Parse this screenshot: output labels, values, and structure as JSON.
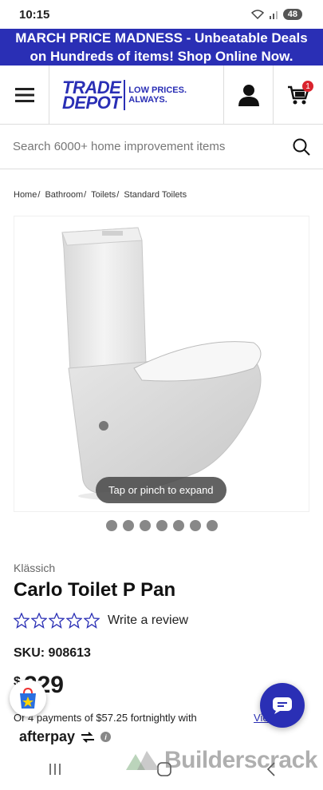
{
  "status_bar": {
    "time": "10:15",
    "battery": "48"
  },
  "promo_banner": {
    "line1": "MARCH PRICE MADNESS - Unbeatable Deals",
    "line2": "on Hundreds of items! Shop Online Now."
  },
  "header": {
    "logo_line1": "TRADE",
    "logo_line2": "DEPOT",
    "tagline_line1": "LOW PRICES.",
    "tagline_line2": "ALWAYS.",
    "cart_count": "1"
  },
  "search": {
    "placeholder": "Search 6000+ home improvement items"
  },
  "breadcrumb": [
    "Home",
    "Bathroom",
    "Toilets",
    "Standard Toilets"
  ],
  "gallery": {
    "tooltip": "Tap or pinch to expand",
    "dot_count": 7
  },
  "product": {
    "brand": "Klässich",
    "title": "Carlo Toilet P Pan",
    "write_review": "Write a review",
    "sku": "SKU: 908613",
    "currency": "$",
    "price": "229",
    "installments": "Or 4 payments of $57.25 fortnightly with",
    "view_link": "View",
    "afterpay": "afterpay"
  },
  "watermark": "Builderscrack",
  "colors": {
    "brand_blue": "#2a2fb5",
    "badge_red": "#d9232d"
  }
}
